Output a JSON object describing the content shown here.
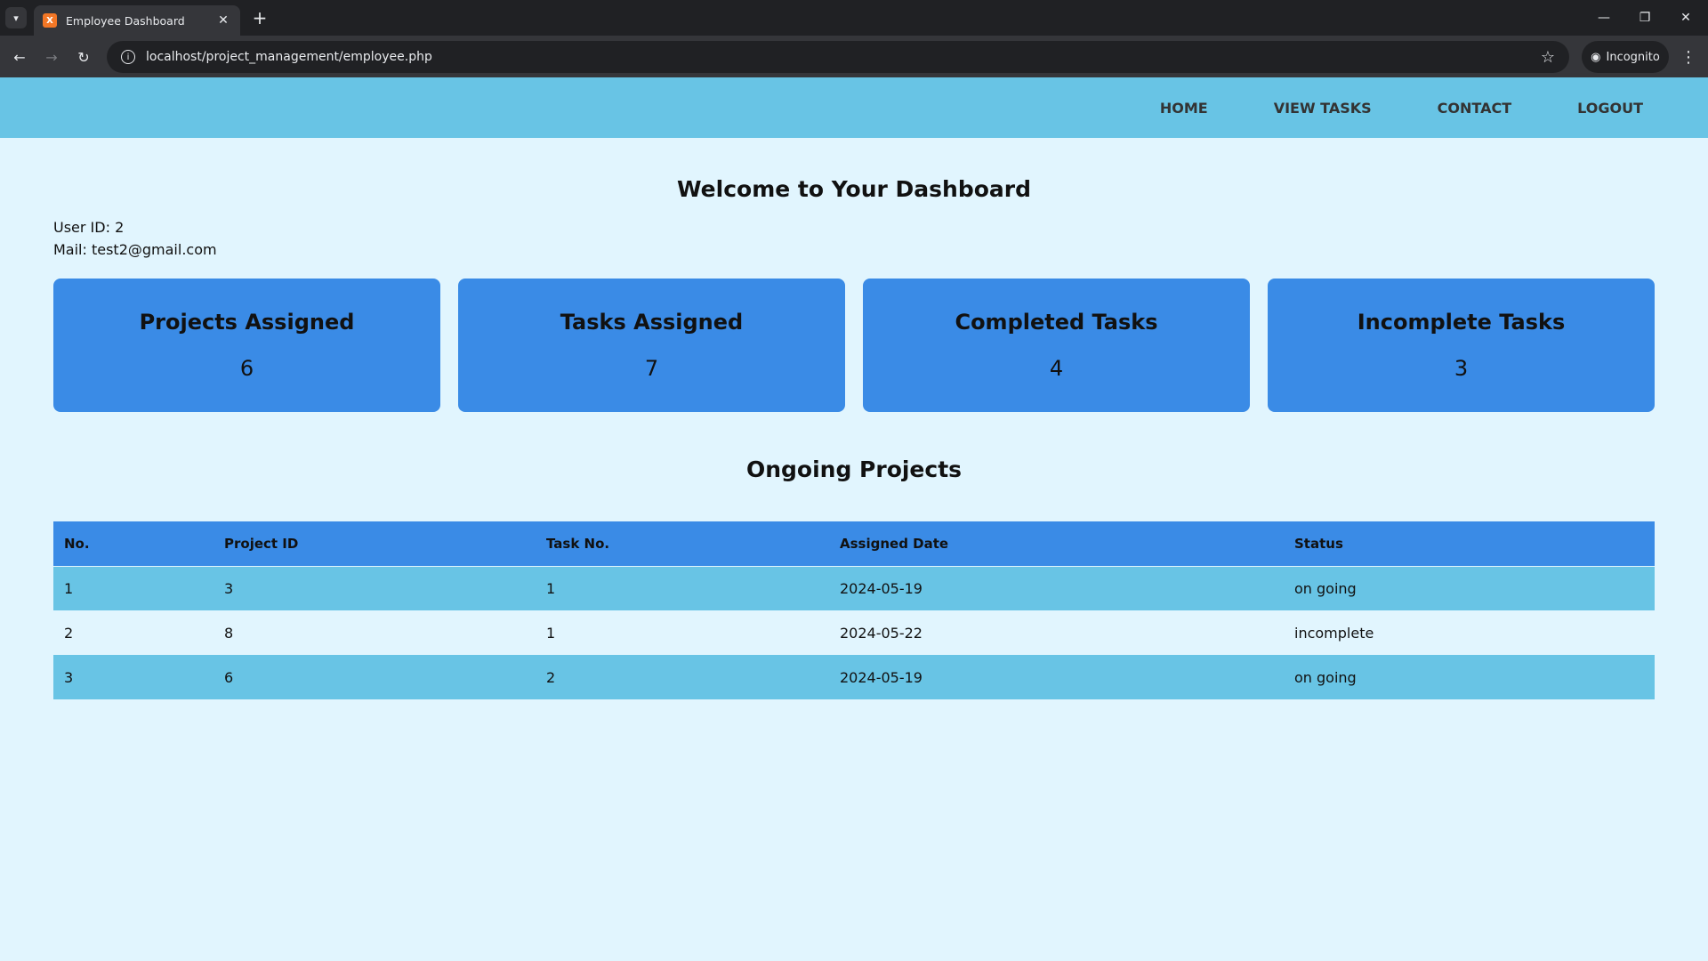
{
  "browser": {
    "tab_title": "Employee Dashboard",
    "favicon_letter": "X",
    "url": "localhost/project_management/employee.php",
    "incognito_label": "Incognito"
  },
  "nav": {
    "items": [
      "HOME",
      "VIEW TASKS",
      "CONTACT",
      "LOGOUT"
    ]
  },
  "welcome": "Welcome to Your Dashboard",
  "user": {
    "id_line": "User ID: 2",
    "mail_line": "Mail: test2@gmail.com"
  },
  "cards": [
    {
      "title": "Projects Assigned",
      "value": "6"
    },
    {
      "title": "Tasks Assigned",
      "value": "7"
    },
    {
      "title": "Completed Tasks",
      "value": "4"
    },
    {
      "title": "Incomplete Tasks",
      "value": "3"
    }
  ],
  "projects": {
    "title": "Ongoing Projects",
    "columns": [
      "No.",
      "Project ID",
      "Task No.",
      "Assigned Date",
      "Status"
    ],
    "rows": [
      [
        "1",
        "3",
        "1",
        "2024-05-19",
        "on going"
      ],
      [
        "2",
        "8",
        "1",
        "2024-05-22",
        "incomplete"
      ],
      [
        "3",
        "6",
        "2",
        "2024-05-19",
        "on going"
      ]
    ]
  },
  "colors": {
    "navbar": "#68c4e5",
    "card": "#3a8be6",
    "page_bg": "#e1f5fe"
  }
}
